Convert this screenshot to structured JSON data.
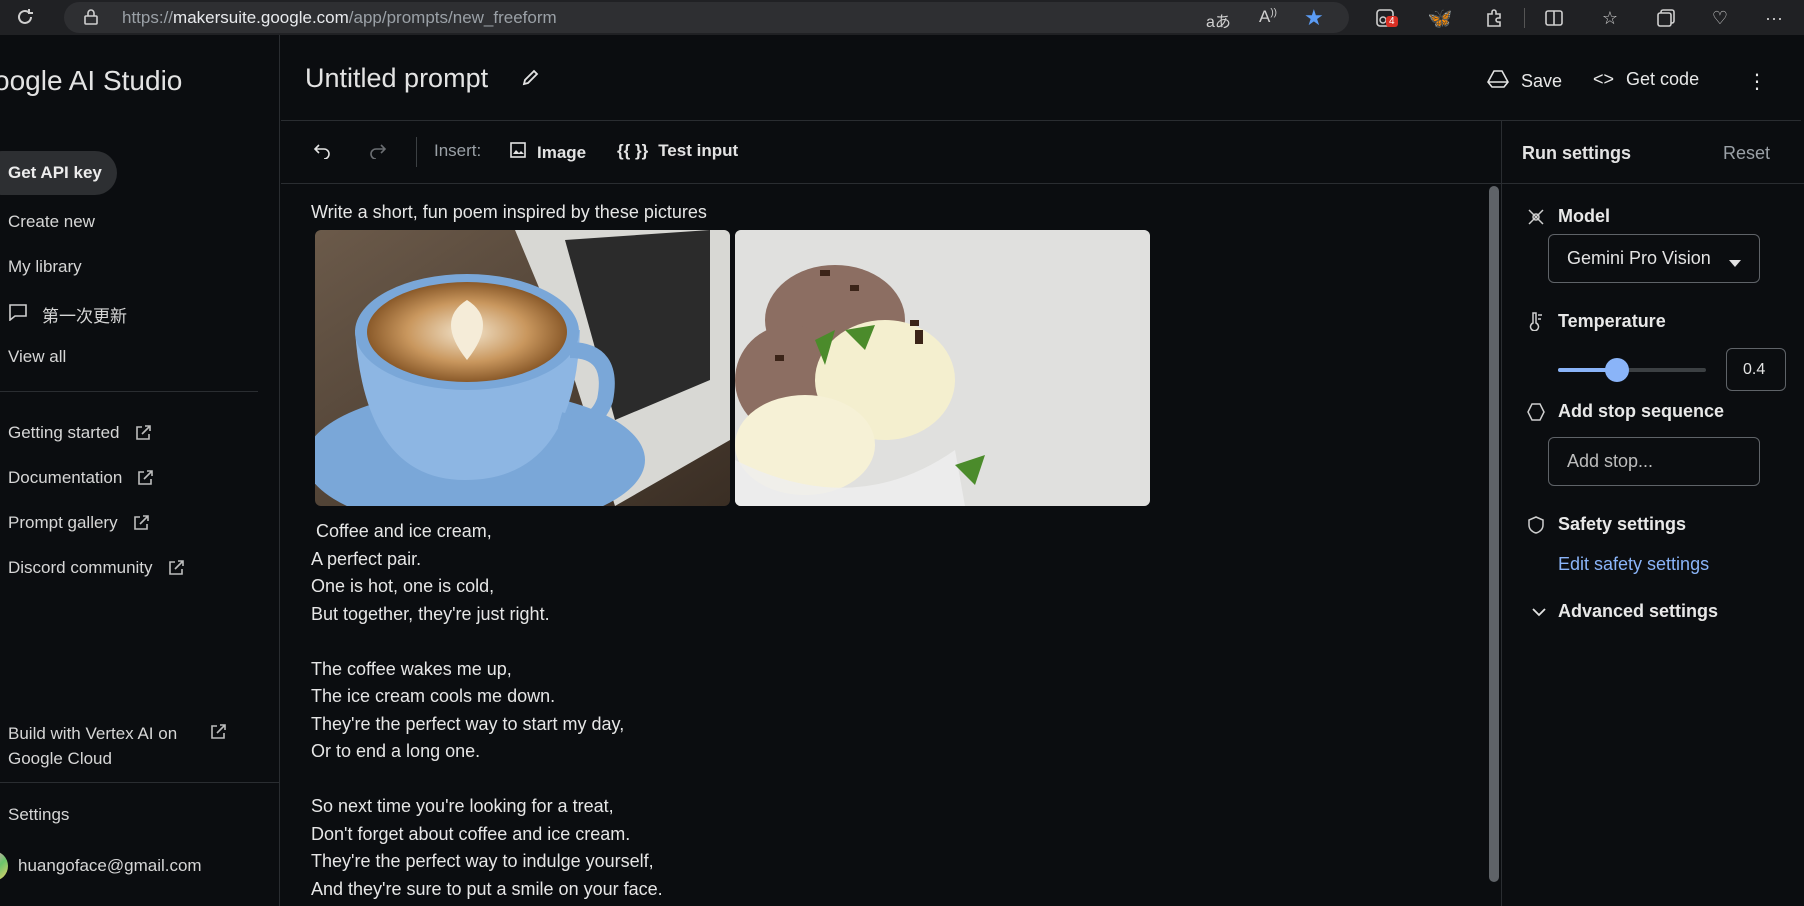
{
  "browser": {
    "url_prefix": "https://",
    "url_host": "makersuite.google.com",
    "url_path": "/app/prompts/new_freeform",
    "badge_count": "4"
  },
  "sidebar": {
    "app_title": "oogle AI Studio",
    "get_api_key": "Get API key",
    "create_new": "Create new",
    "my_library": "My library",
    "recent_prompt": "第一次更新",
    "view_all": "View all",
    "getting_started": "Getting started",
    "documentation": "Documentation",
    "prompt_gallery": "Prompt gallery",
    "discord": "Discord community",
    "vertex_line1": "Build with Vertex AI on",
    "vertex_line2": "Google Cloud",
    "settings": "Settings",
    "account": "huangoface@gmail.com"
  },
  "header": {
    "title": "Untitled prompt",
    "save": "Save",
    "get_code": "Get code"
  },
  "toolbar": {
    "insert_label": "Insert:",
    "image_label": "Image",
    "test_input_braces": "{{ }}",
    "test_input_label": "Test input"
  },
  "editor": {
    "prompt_text": "Write a short, fun poem inspired by these pictures",
    "poem": " Coffee and ice cream,\nA perfect pair.\nOne is hot, one is cold,\nBut together, they're just right.\n\nThe coffee wakes me up,\nThe ice cream cools me down.\nThey're the perfect way to start my day,\nOr to end a long one.\n\nSo next time you're looking for a treat,\nDon't forget about coffee and ice cream.\nThey're the perfect way to indulge yourself,\nAnd they're sure to put a smile on your face."
  },
  "run_settings": {
    "title": "Run settings",
    "reset": "Reset",
    "model_label": "Model",
    "model_value": "Gemini Pro Vision",
    "temperature_label": "Temperature",
    "temperature_value": "0.4",
    "temperature_fraction": 0.4,
    "stop_label": "Add stop sequence",
    "stop_placeholder": "Add stop...",
    "safety_label": "Safety settings",
    "edit_safety": "Edit safety settings",
    "advanced": "Advanced settings"
  },
  "colors": {
    "accent": "#8ab4f8",
    "background": "#0b0d10"
  }
}
